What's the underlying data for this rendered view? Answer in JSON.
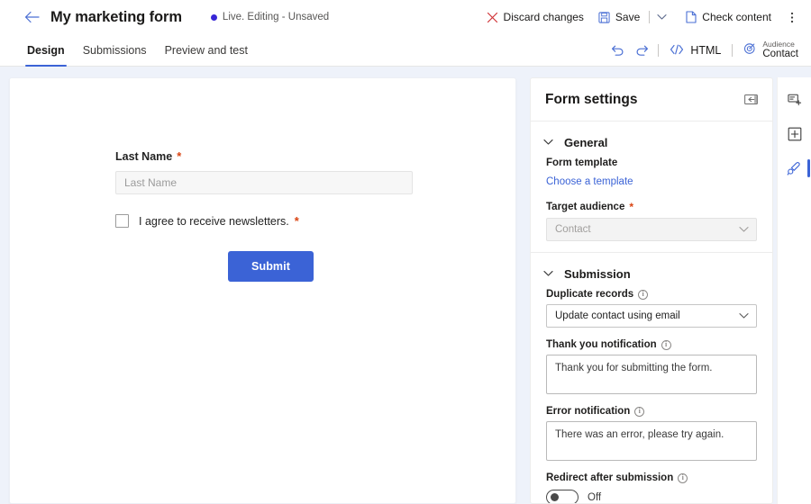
{
  "topbar": {
    "back_icon": "arrow-left-icon",
    "title": "My marketing form",
    "status_text": "Live. Editing - Unsaved",
    "status_color": "#3826d6",
    "discard_label": "Discard changes",
    "discard_icon": "close-x-icon",
    "save_label": "Save",
    "save_icon": "save-disk-icon",
    "save_chevron_icon": "chevron-down-icon",
    "check_content_label": "Check content",
    "check_content_icon": "document-icon",
    "overflow_icon": "more-vertical-icon"
  },
  "tabbar": {
    "tabs": [
      {
        "label": "Design",
        "active": true
      },
      {
        "label": "Submissions",
        "active": false
      },
      {
        "label": "Preview and test",
        "active": false
      }
    ],
    "undo_icon": "undo-icon",
    "redo_icon": "redo-icon",
    "html_label": "HTML",
    "html_icon": "code-brackets-icon",
    "audience_icon": "target-icon",
    "audience_caption": "Audience",
    "audience_value": "Contact"
  },
  "form": {
    "field_label": "Last Name",
    "field_required_mark": "*",
    "field_placeholder": "Last Name",
    "checkbox_label": "I agree to receive newsletters.",
    "checkbox_required_mark": "*",
    "checkbox_checked": false,
    "submit_label": "Submit",
    "submit_color": "#3b63d6"
  },
  "panel": {
    "title": "Form settings",
    "collapse_icon": "panel-collapse-icon",
    "general": {
      "section_title": "General",
      "expanded": true,
      "chevron_icon": "chevron-down-icon",
      "form_template_label": "Form template",
      "choose_template_link": "Choose a template",
      "target_audience_label": "Target audience",
      "target_audience_required_mark": "*",
      "target_audience_value": "Contact",
      "target_audience_disabled": true
    },
    "submission": {
      "section_title": "Submission",
      "expanded": true,
      "chevron_icon": "chevron-down-icon",
      "duplicate_records_label": "Duplicate records",
      "duplicate_records_value": "Update contact using email",
      "thank_you_label": "Thank you notification",
      "thank_you_value": "Thank you for submitting the form.",
      "error_label": "Error notification",
      "error_value": "There was an error, please try again.",
      "redirect_label": "Redirect after submission",
      "redirect_state": "Off",
      "redirect_on": false,
      "info_icon": "info-circle-icon"
    }
  },
  "rail": {
    "items": [
      {
        "name": "add-field-icon",
        "active": false
      },
      {
        "name": "add-section-icon",
        "active": false
      },
      {
        "name": "style-brush-icon",
        "active": true
      }
    ]
  }
}
